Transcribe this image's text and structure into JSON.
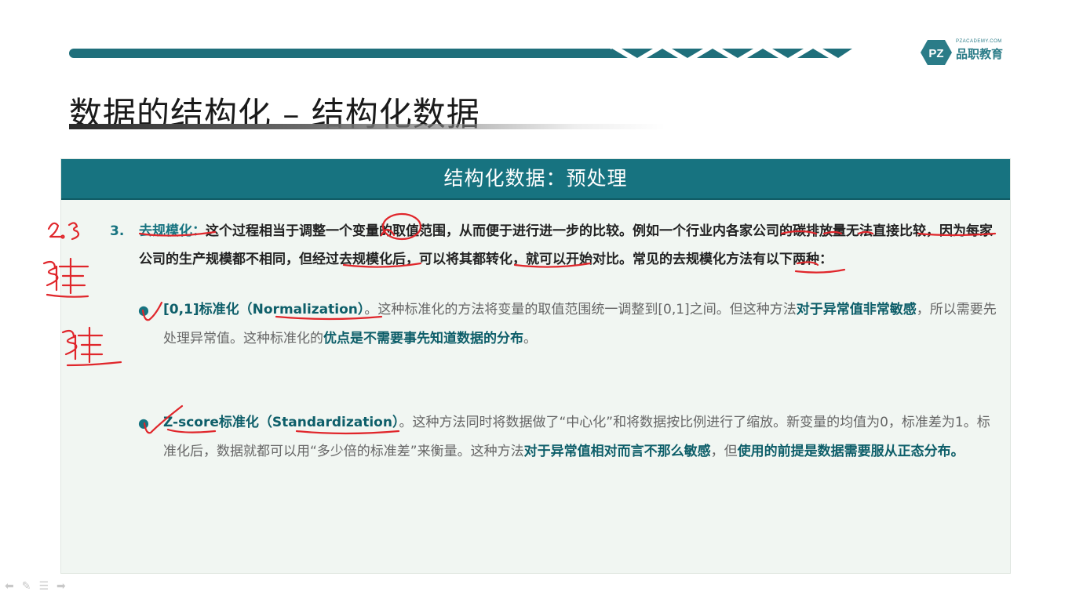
{
  "logo": {
    "small": "PZACADEMY.COM",
    "name": "品职教育",
    "mark": "PZ"
  },
  "title": "数据的结构化 – 结构化数据",
  "panel_header": "结构化数据：预处理",
  "item3": {
    "number": "3.",
    "term": "去规模化：",
    "text": "这个过程相当于调整一个变量的取值范围，从而便于进行进一步的比较。例如一个行业内各家公司的碳排放量无法直接比较，因为每家公司的生产规模都不相同，但经过去规模化后，可以将其都转化，就可以开始对比。常见的去规模化方法有以下两种："
  },
  "bullet1": {
    "term": "[0,1]标准化（Normalization）",
    "text1": "。这种标准化的方法将变量的取值范围统一调整到[0,1]之间。但这种方法",
    "em1": "对于异常值非常敏感",
    "text2": "，所以需要先处理异常值。这种标准化的",
    "em2": "优点是不需要事先知道数据的分布",
    "text3": "。"
  },
  "bullet2": {
    "term": "Z-score标准化（Standardization）",
    "text1": "。这种方法同时将数据做了“中心化”和将数据按比例进行了缩放。新变量的均值为0，标准差为1。标准化后，数据就都可以用“多少倍的标准差”来衡量。这种方法",
    "em1": "对于异常值相对而言不那么敏感",
    "text2": "，但",
    "em2": "使用的前提是数据需要服从正态分布。"
  },
  "colors": {
    "accent": "#177380",
    "annotation": "#e0262b"
  }
}
